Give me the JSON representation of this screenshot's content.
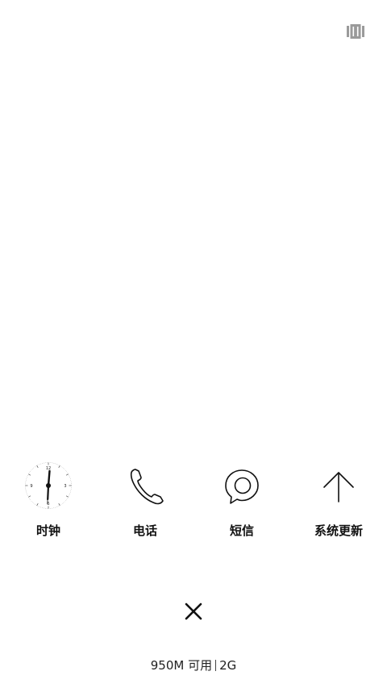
{
  "header": {
    "manage_icon": "multitask-manage-icon"
  },
  "recent_apps": [
    {
      "label": "时钟",
      "icon": "clock-icon"
    },
    {
      "label": "电话",
      "icon": "phone-icon"
    },
    {
      "label": "短信",
      "icon": "message-icon"
    },
    {
      "label": "系统更新",
      "icon": "arrow-up-icon"
    }
  ],
  "clock_face": {
    "n12": "12",
    "n3": "3",
    "n6": "6",
    "n9": "9"
  },
  "footer": {
    "close_icon": "close-icon",
    "memory_available": "950M 可用",
    "memory_total": "2G"
  },
  "colors": {
    "background": "#ffffff",
    "icon_stroke": "#111111",
    "manage_icon": "#9a9a9a"
  }
}
